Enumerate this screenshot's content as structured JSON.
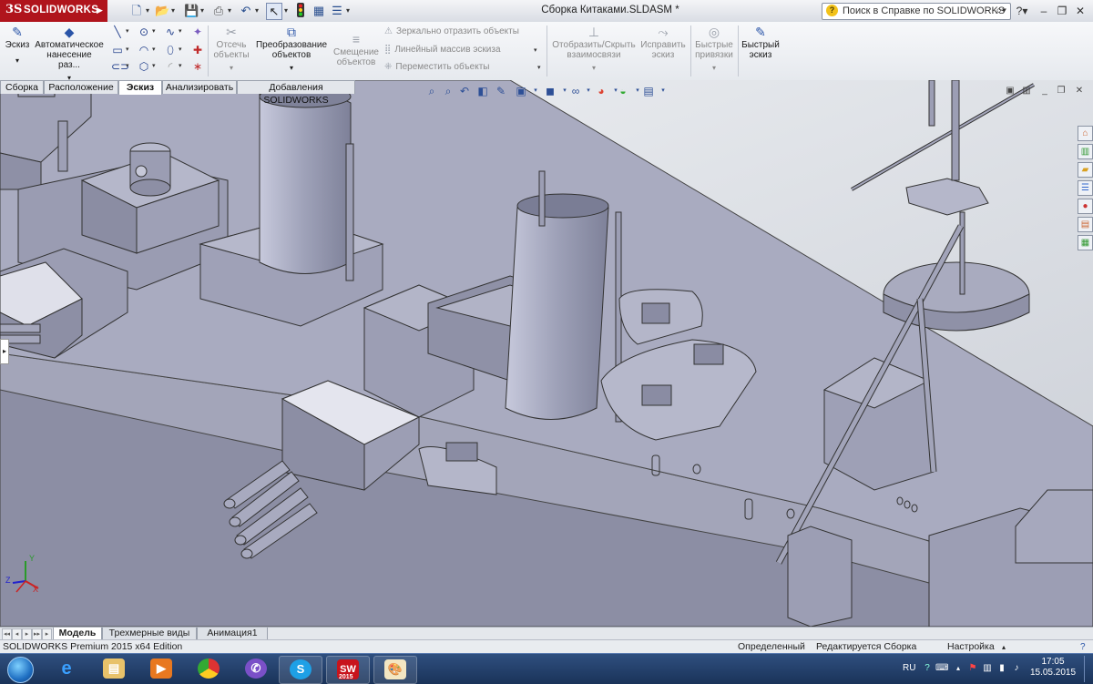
{
  "titlebar": {
    "brand": "SOLIDWORKS",
    "brand_mark": "3S",
    "document_title": "Сборка Китаками.SLDASM *",
    "help_search_placeholder": "Поиск в Справке по SOLIDWORKS",
    "quick_access_icons": [
      "new-file-icon",
      "open-folder-icon",
      "save-icon",
      "print-icon",
      "undo-icon",
      "select-cursor-icon",
      "rebuild-traffic-light-icon",
      "file-properties-icon",
      "options-icon"
    ]
  },
  "command_manager": {
    "sketch": "Эскиз",
    "auto_dimension": "Автоматическое нанесение раз...",
    "trim": "Отсечь объекты",
    "convert": "Преобразование объектов",
    "offset": "Смещение объектов",
    "mirror": "Зеркально отразить объекты",
    "linear_pattern": "Линейный массив эскиза",
    "move": "Переместить объекты",
    "display_relations": "Отобразить/Скрыть взаимосвязи",
    "repair": "Исправить эскиз",
    "quick_snaps": "Быстрые привязки",
    "rapid_sketch": "Быстрый эскиз"
  },
  "tabs": [
    {
      "label": "Сборка",
      "active": false
    },
    {
      "label": "Расположение",
      "active": false
    },
    {
      "label": "Эскиз",
      "active": true
    },
    {
      "label": "Анализировать",
      "active": false
    },
    {
      "label": "Добавления SOLIDWORKS",
      "active": false
    }
  ],
  "bottom_tabs": [
    {
      "label": "Модель",
      "active": true
    },
    {
      "label": "Трехмерные виды",
      "active": false
    },
    {
      "label": "Анимация1",
      "active": false
    }
  ],
  "statusbar": {
    "product": "SOLIDWORKS Premium 2015 x64 Edition",
    "state": "Определенный",
    "editing": "Редактируется Сборка",
    "custom": "Настройка"
  },
  "triad": {
    "x": "X",
    "y": "Y",
    "z": "Z"
  },
  "taskbar": {
    "apps": [
      "internet-explorer",
      "file-explorer",
      "media-player",
      "chrome",
      "viber",
      "skype",
      "solidworks-2015",
      "paint"
    ],
    "sw_label": "2015",
    "language": "RU",
    "time": "17:05",
    "date": "15.05.2015"
  },
  "colors": {
    "brand_red": "#b0141c",
    "hull": "#a9abc0",
    "taskbar": "#1f3b66"
  }
}
